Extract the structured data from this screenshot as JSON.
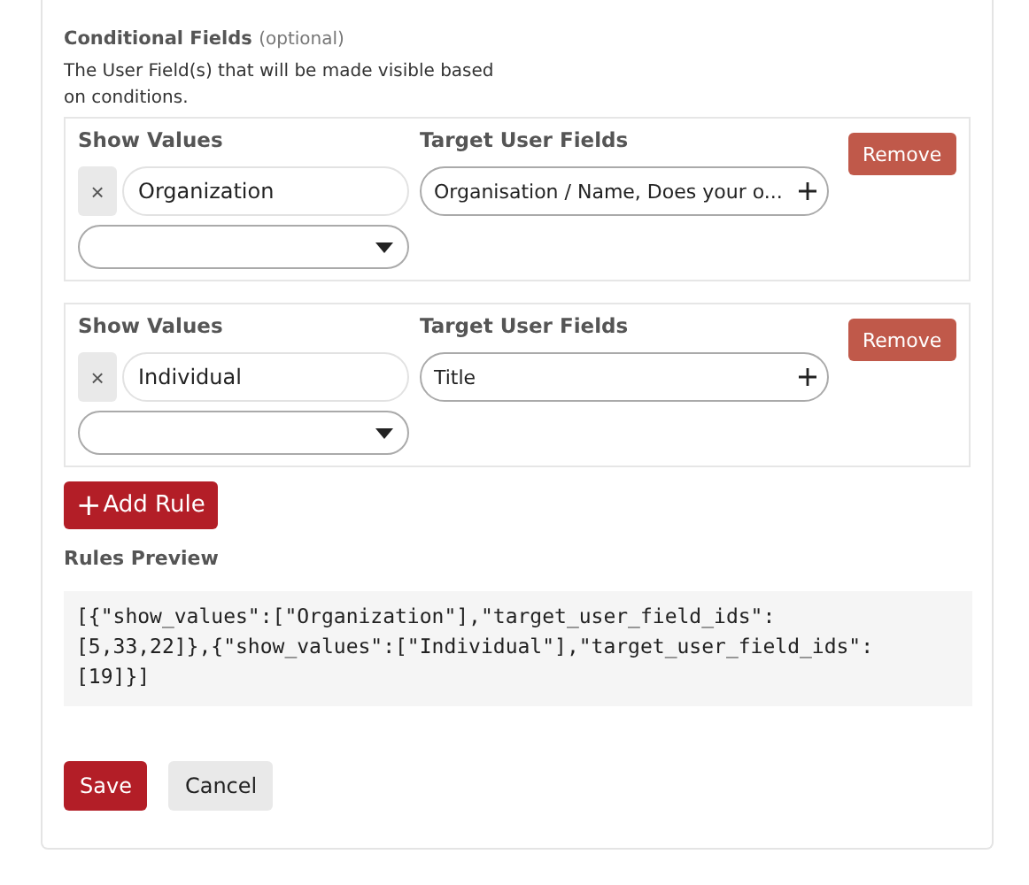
{
  "section": {
    "title": "Conditional Fields",
    "note": "(optional)",
    "description": "The User Field(s) that will be made visible based on conditions."
  },
  "rules": [
    {
      "show_values_label": "Show Values",
      "clear": "×",
      "value": "Organization",
      "target_label": "Target User Fields",
      "target_value": "Organisation / Name, Does your o...",
      "remove": "Remove"
    },
    {
      "show_values_label": "Show Values",
      "clear": "×",
      "value": "Individual",
      "target_label": "Target User Fields",
      "target_value": "Title",
      "remove": "Remove"
    }
  ],
  "add_rule": {
    "icon": "+",
    "label": "Add Rule"
  },
  "preview": {
    "title": "Rules Preview",
    "lines": [
      "[{\"show_values\":[\"Organization\"],\"target_user_field_ids\":",
      "[5,33,22]},{\"show_values\":[\"Individual\"],\"target_user_field_ids\":",
      "[19]}]"
    ]
  },
  "buttons": [
    {
      "label": "Save",
      "kind": "primary"
    },
    {
      "label": "Cancel",
      "kind": "secondary"
    }
  ]
}
